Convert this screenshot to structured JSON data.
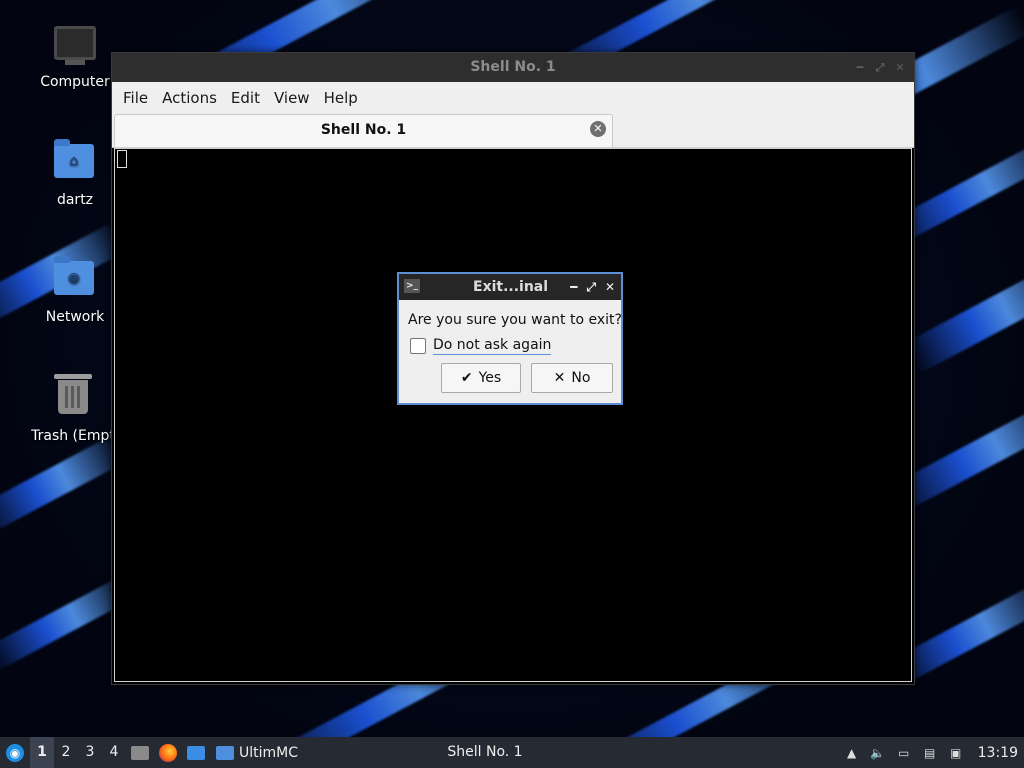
{
  "desktop": {
    "icons": [
      {
        "label": "Computer",
        "icon": "computer-icon"
      },
      {
        "label": "dartz",
        "icon": "home-folder-icon"
      },
      {
        "label": "Network",
        "icon": "network-folder-icon"
      },
      {
        "label": "Trash (Empt",
        "icon": "trash-icon"
      }
    ]
  },
  "window": {
    "title": "Shell No. 1",
    "menu": [
      "File",
      "Actions",
      "Edit",
      "View",
      "Help"
    ],
    "tab": {
      "label": "Shell No. 1"
    }
  },
  "dialog": {
    "title": "Exit...inal",
    "message": "Are you sure you want to exit?",
    "checkbox_label": "Do not ask again",
    "checkbox_checked": false,
    "yes_label": "Yes",
    "no_label": "No",
    "yes_icon": "✔",
    "no_icon": "✕"
  },
  "taskbar": {
    "workspaces": [
      "1",
      "2",
      "3",
      "4"
    ],
    "active_workspace": "1",
    "task_folder": "UltimMC",
    "task_active": "Shell No. 1",
    "clock": "13:19"
  },
  "colors": {
    "accent": "#5d8fd8",
    "taskbar_bg": "#252a33",
    "terminal_bg": "#000000"
  }
}
